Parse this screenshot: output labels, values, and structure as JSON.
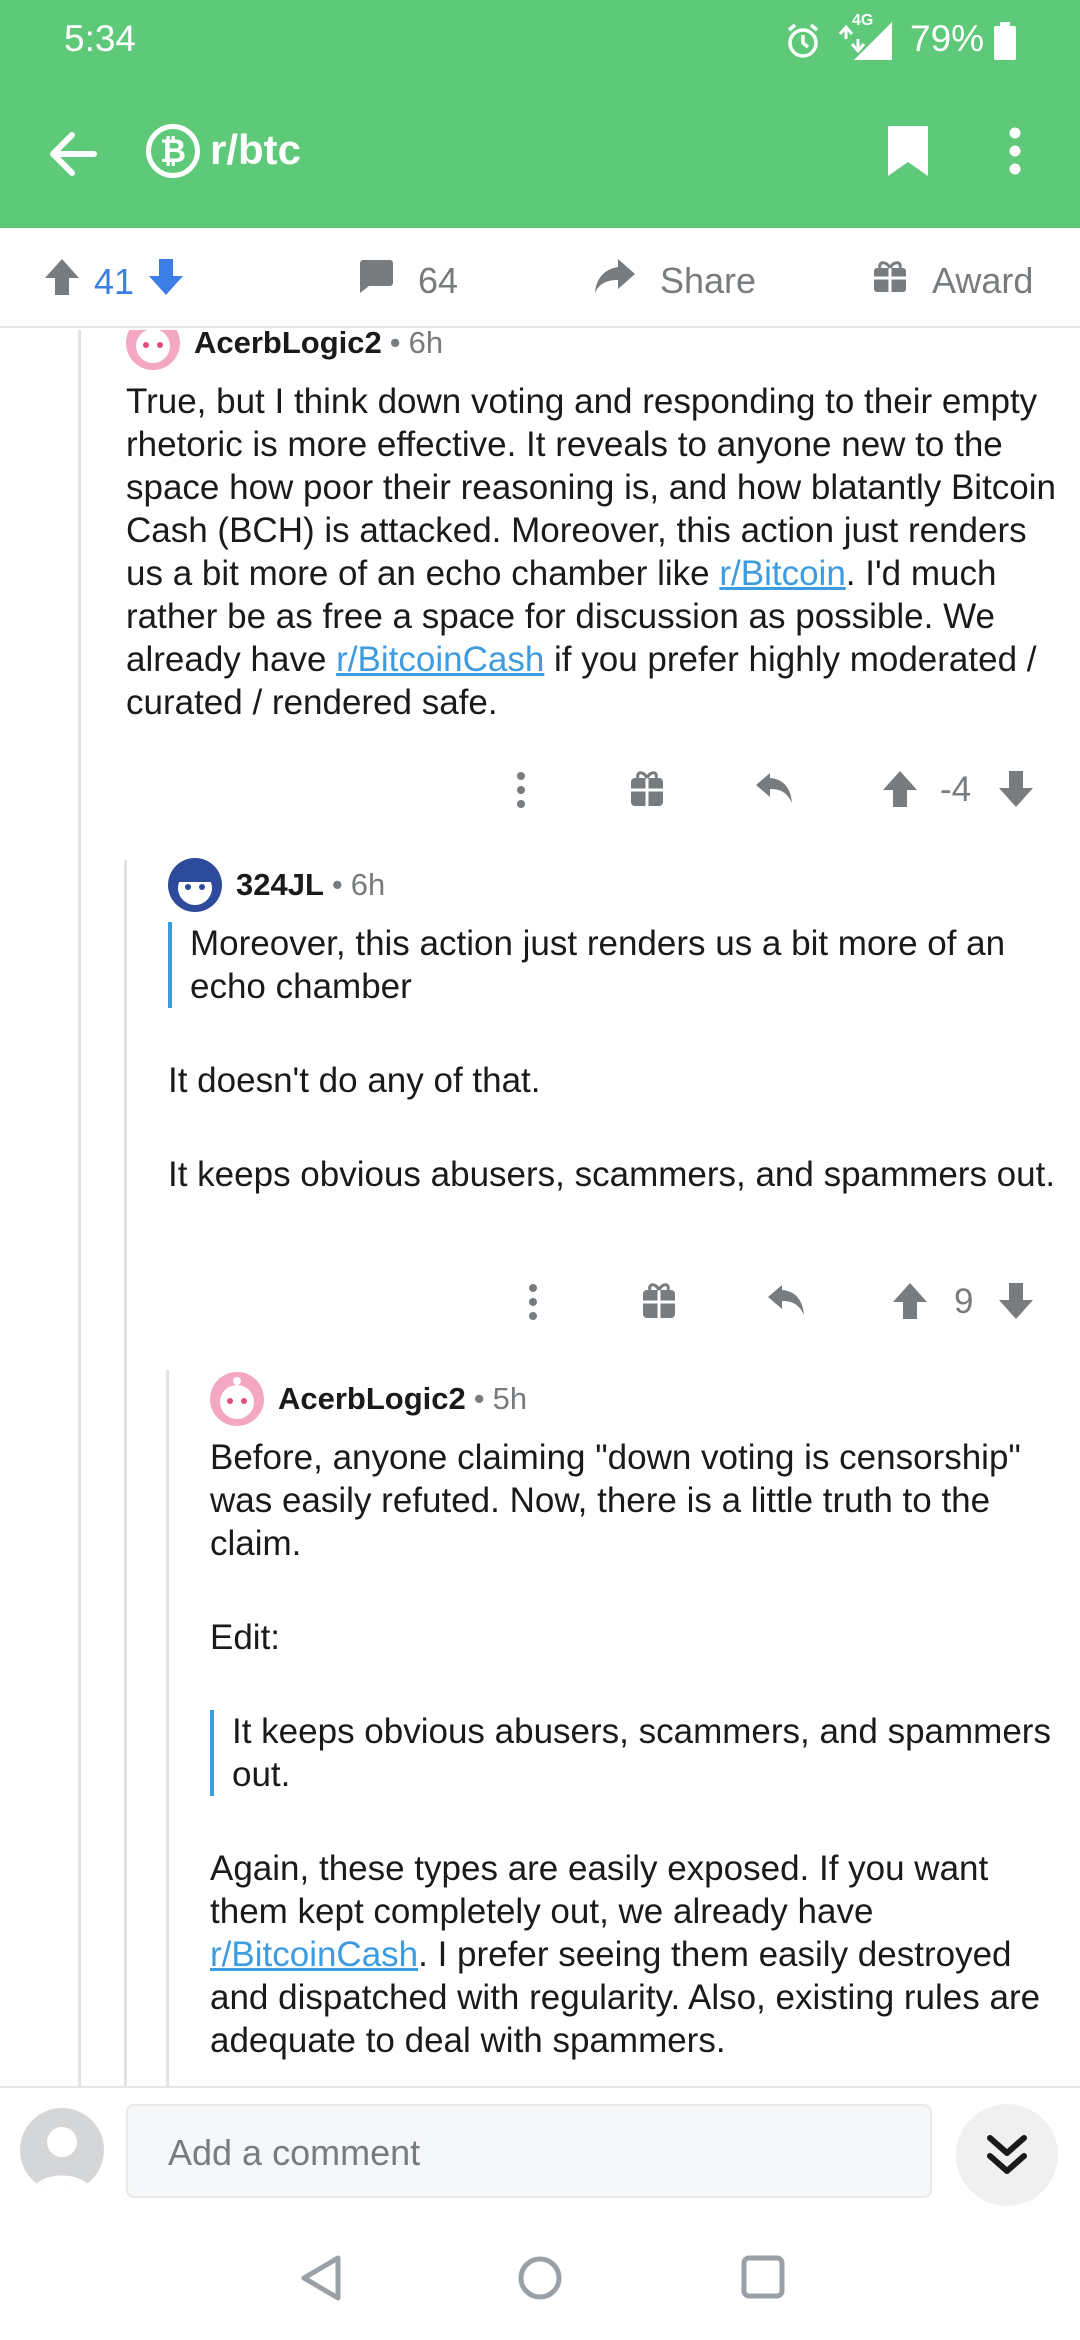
{
  "status_bar": {
    "time": "5:34",
    "network": "4G",
    "battery": "79%"
  },
  "app_bar": {
    "subreddit": "r/btc",
    "logo": "₿"
  },
  "post_bar": {
    "upvotes": "41",
    "comments": "64",
    "share_label": "Share",
    "award_label": "Award"
  },
  "comments": [
    {
      "author": "AcerbLogic2",
      "dot": "•",
      "age": "6h",
      "score": "-4",
      "parts": [
        "True, but I think down voting and responding to their empty rhetoric is more effective. It reveals to anyone new to the space how poor their reasoning is, and how blatantly Bitcoin Cash (BCH) is attacked. Moreover, this action just renders us a bit more of an echo chamber like ",
        "r/Bitcoin",
        ". I'd much rather be as free a space for discussion as possible. We already have ",
        "r/BitcoinCash",
        " if you prefer highly moderated / curated / rendered safe."
      ]
    },
    {
      "author": "324JL",
      "dot": "•",
      "age": "6h",
      "score": "9",
      "quote": "Moreover, this action just renders us a bit more of an echo chamber",
      "p1": "It doesn't do any of that.",
      "p2": "It keeps obvious abusers, scammers, and spammers out."
    },
    {
      "author": "AcerbLogic2",
      "dot": "•",
      "age": "5h",
      "p1": "Before, anyone claiming \"down voting is censorship\" was easily refuted. Now, there is a little truth to the claim.",
      "p2": "Edit:",
      "quote": "It keeps obvious abusers, scammers, and spammers out.",
      "p3_parts": [
        "Again, these types are easily exposed. If you want them kept completely out, we already have ",
        "r/BitcoinCash",
        ". I prefer seeing them easily destroyed and dispatched with regularity. Also, existing rules are adequate to deal with spammers."
      ]
    }
  ],
  "composer": {
    "placeholder": "Add a comment"
  },
  "colors": {
    "header": "#5ec978",
    "upvote_blue": "#3d7ee6",
    "link": "#3d9be0",
    "meta_gray": "#787c7e"
  },
  "icons": [
    "back-arrow-icon",
    "bitcoin-icon",
    "bookmark-icon",
    "more-vert-icon",
    "upvote-icon",
    "downvote-icon",
    "comment-icon",
    "share-icon",
    "gift-icon",
    "reply-icon",
    "double-chevron-down-icon"
  ]
}
